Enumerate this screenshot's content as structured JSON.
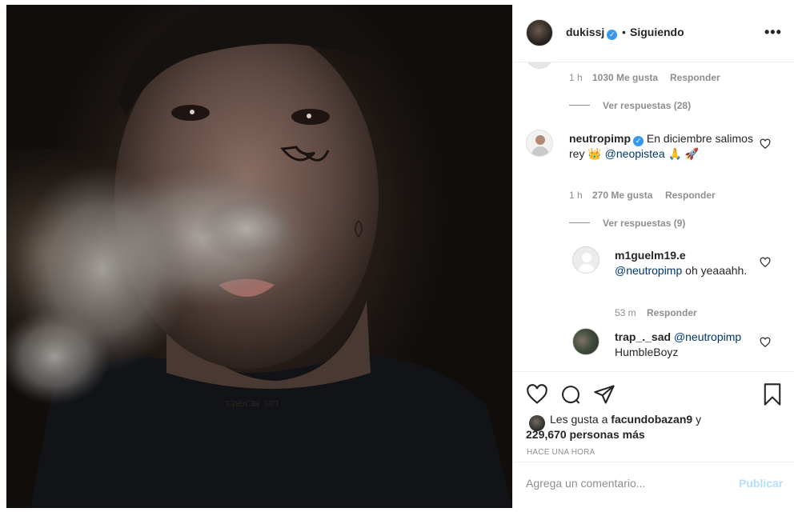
{
  "post": {
    "username": "dukissj",
    "verified_icon": "verified-badge-icon",
    "separator": "•",
    "follow_status": "Siguiendo",
    "more_icon": "more-options-icon",
    "more_text": "•••"
  },
  "comments": {
    "first": {
      "time": "1 h",
      "likes": "1030 Me gusta",
      "reply": "Responder",
      "view_replies": "Ver respuestas (28)"
    },
    "second": {
      "username": "neutropimp",
      "text_a": "En diciembre salimos rey",
      "emoji_crown": "👑",
      "mention": "@neopistea",
      "emoji_pray": "🙏",
      "emoji_rocket": "🚀",
      "time": "1 h",
      "likes": "270 Me gusta",
      "reply": "Responder",
      "view_replies": "Ver respuestas (9)"
    },
    "reply_one": {
      "username": "m1guelm19.e",
      "mention": "@neutropimp",
      "text": "oh yeaaahh.",
      "time": "53 m",
      "reply": "Responder"
    },
    "reply_two": {
      "username": "trap_._sad",
      "mention": "@neutropimp",
      "text": "HumbleBoyz"
    }
  },
  "actions": {
    "like_icon": "heart-icon",
    "comment_icon": "comment-icon",
    "share_icon": "paper-plane-icon",
    "save_icon": "bookmark-icon"
  },
  "likes": {
    "prefix": "Les gusta a",
    "user": "facundobazan9",
    "connector": "y",
    "count": "229,670 personas más"
  },
  "timestamp": "HACE UNA HORA",
  "composer": {
    "placeholder": "Agrega un comentario...",
    "publish_label": "Publicar"
  },
  "colors": {
    "accent": "#3897f0",
    "publish_disabled": "#b2dffc",
    "mention": "#00376b",
    "muted": "#8e8e8e"
  }
}
